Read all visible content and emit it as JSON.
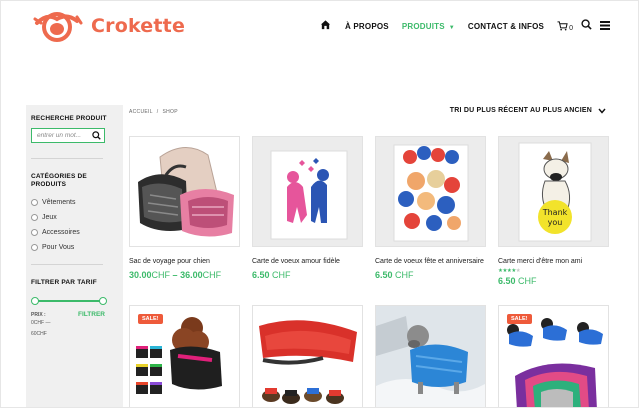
{
  "brand": {
    "name": "Crokette",
    "color": "#ee6a4e"
  },
  "accent": "#3cba6a",
  "nav": {
    "items": [
      "À PROPOS",
      "PRODUITS",
      "CONTACT & INFOS"
    ],
    "cart_count": "0"
  },
  "sidebar": {
    "search_title": "RECHERCHE PRODUIT",
    "search_placeholder": "entrer un mot...",
    "categories_title": "CATÉGORIES DE PRODUITS",
    "categories": [
      "Vêtements",
      "Jeux",
      "Accessoires",
      "Pour Vous"
    ],
    "price_title": "FILTRER PAR TARIF",
    "price_label": "PRIX :",
    "price_min": "0CHF —",
    "price_max": "60CHF",
    "filter_label": "FILTRER"
  },
  "breadcrumb": {
    "home": "ACCUEIL",
    "sep": "/",
    "current": "SHOP"
  },
  "sort_label": "TRI DU PLUS RÉCENT AU PLUS ANCIEN",
  "products": [
    {
      "name": "Sac de voyage pour chien",
      "price_from": "30.00",
      "dash": "–",
      "price_to": "36.00",
      "currency": "CHF"
    },
    {
      "name": "Carte de voeux amour fidèle",
      "price": "6.50",
      "currency": "CHF"
    },
    {
      "name": "Carte de voeux fête et anniversaire",
      "price": "6.50",
      "currency": "CHF"
    },
    {
      "name": "Carte merci d'être mon ami",
      "rating": 4,
      "price": "6.50",
      "currency": "CHF"
    }
  ],
  "row2": [
    {
      "badge": "SALE!"
    },
    {
      "badge": ""
    },
    {
      "badge": ""
    },
    {
      "badge": "SALE!"
    }
  ]
}
